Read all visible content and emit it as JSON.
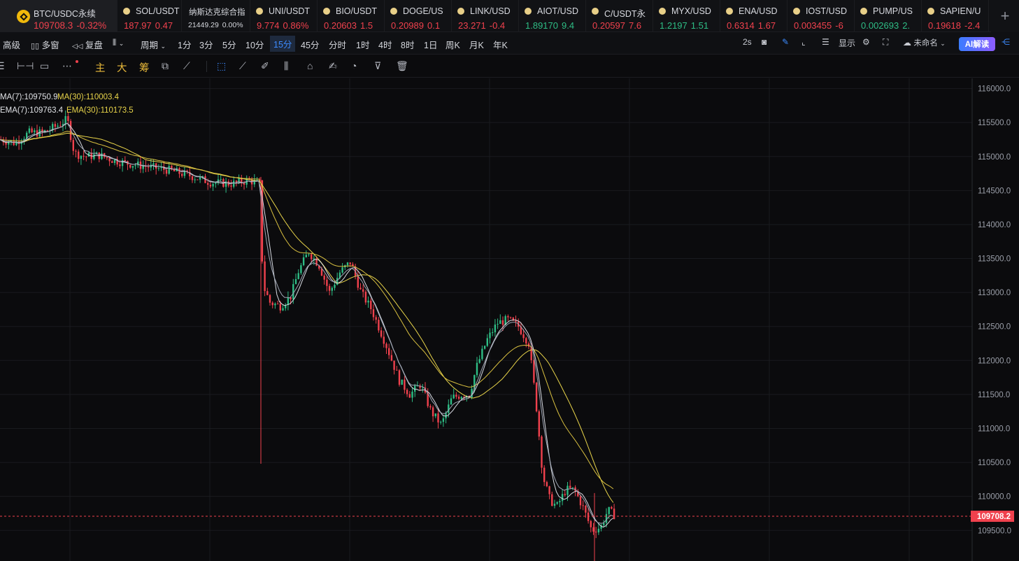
{
  "tickers": [
    {
      "name": "BTC/USDC永续",
      "price": "109708.3",
      "change": "-0.32%",
      "dir": "dn",
      "active": true,
      "w": 168
    },
    {
      "name": "SOL/USDT",
      "price": "187.97",
      "change": "0.47",
      "dir": "dn",
      "w": 92
    },
    {
      "name": "纳斯达克综合指",
      "price": "21449.29",
      "change": "0.00%",
      "dir": "flat",
      "w": 98,
      "nodot": true
    },
    {
      "name": "UNI/USDT",
      "price": "9.774",
      "change": "0.86%",
      "dir": "dn",
      "w": 96
    },
    {
      "name": "BIO/USDT",
      "price": "0.20603",
      "change": "1.5",
      "dir": "dn",
      "w": 96
    },
    {
      "name": "DOGE/US",
      "price": "0.20989",
      "change": "0.1",
      "dir": "dn",
      "w": 96
    },
    {
      "name": "LINK/USD",
      "price": "23.271",
      "change": "-0.4",
      "dir": "dn",
      "w": 96
    },
    {
      "name": "AIOT/USD",
      "price": "1.89170",
      "change": "9.4",
      "dir": "up",
      "w": 96
    },
    {
      "name": "C/USDT永",
      "price": "0.20597",
      "change": "7.6",
      "dir": "dn",
      "w": 96
    },
    {
      "name": "MYX/USD",
      "price": "1.2197",
      "change": "1.51",
      "dir": "up",
      "w": 96
    },
    {
      "name": "ENA/USD",
      "price": "0.6314",
      "change": "1.67",
      "dir": "dn",
      "w": 96
    },
    {
      "name": "IOST/USD",
      "price": "0.003455",
      "change": "-6",
      "dir": "dn",
      "w": 96
    },
    {
      "name": "PUMP/US",
      "price": "0.002693",
      "change": "2.",
      "dir": "up",
      "w": 96
    },
    {
      "name": "SAPIEN/U",
      "price": "0.19618",
      "change": "-2.4",
      "dir": "dn",
      "w": 96
    }
  ],
  "toolbar": {
    "advanced": "高级",
    "multi_window": "多窗",
    "replay": "复盘",
    "period": "周期",
    "intervals": [
      "1分",
      "3分",
      "5分",
      "10分",
      "15分",
      "45分",
      "分时",
      "1时",
      "4时",
      "8时",
      "1日",
      "周K",
      "月K",
      "年K"
    ],
    "selected_interval": "15分",
    "refresh": "2s",
    "display": "显示",
    "unnamed": "未命名",
    "ai": "AI解读"
  },
  "draw_tools": {
    "main": "主",
    "big": "大",
    "chips": "筹"
  },
  "legend": {
    "ma7": "MA(7):109750.9",
    "ma30": "MA(30):110003.4",
    "ema7": "EMA(7):109763.4",
    "ema30": "EMA(30):110173.5"
  },
  "chart_data": {
    "type": "candlestick",
    "symbol": "BTC/USDC永续",
    "interval": "15分",
    "y_ticks": [
      116000,
      115500,
      115000,
      114500,
      114000,
      113500,
      113000,
      112500,
      112000,
      111500,
      111000,
      110500,
      110000,
      109500
    ],
    "ylim": [
      109050,
      116150
    ],
    "last_price": 109708.2,
    "grid": true,
    "path_points": [
      [
        0,
        115250
      ],
      [
        20,
        115200
      ],
      [
        40,
        115350
      ],
      [
        60,
        115350
      ],
      [
        80,
        115450
      ],
      [
        95,
        115550
      ],
      [
        105,
        115050
      ],
      [
        120,
        115000
      ],
      [
        140,
        115020
      ],
      [
        160,
        114950
      ],
      [
        180,
        114900
      ],
      [
        210,
        114850
      ],
      [
        240,
        114800
      ],
      [
        270,
        114720
      ],
      [
        300,
        114620
      ],
      [
        330,
        114600
      ],
      [
        355,
        114650
      ],
      [
        370,
        114600
      ],
      [
        375,
        113100
      ],
      [
        385,
        112850
      ],
      [
        400,
        112800
      ],
      [
        415,
        112950
      ],
      [
        425,
        113300
      ],
      [
        440,
        113600
      ],
      [
        455,
        113400
      ],
      [
        470,
        113000
      ],
      [
        485,
        113300
      ],
      [
        500,
        113450
      ],
      [
        515,
        113000
      ],
      [
        530,
        112750
      ],
      [
        550,
        112250
      ],
      [
        570,
        111700
      ],
      [
        585,
        111500
      ],
      [
        600,
        111650
      ],
      [
        615,
        111250
      ],
      [
        630,
        111050
      ],
      [
        645,
        111450
      ],
      [
        660,
        111500
      ],
      [
        670,
        111500
      ],
      [
        680,
        111900
      ],
      [
        695,
        112300
      ],
      [
        710,
        112550
      ],
      [
        725,
        112600
      ],
      [
        740,
        112500
      ],
      [
        755,
        112250
      ],
      [
        765,
        111400
      ],
      [
        775,
        110300
      ],
      [
        785,
        109950
      ],
      [
        795,
        109850
      ],
      [
        808,
        110100
      ],
      [
        820,
        110100
      ],
      [
        832,
        109850
      ],
      [
        845,
        109500
      ],
      [
        858,
        109550
      ],
      [
        868,
        109800
      ],
      [
        878,
        109720
      ]
    ]
  }
}
